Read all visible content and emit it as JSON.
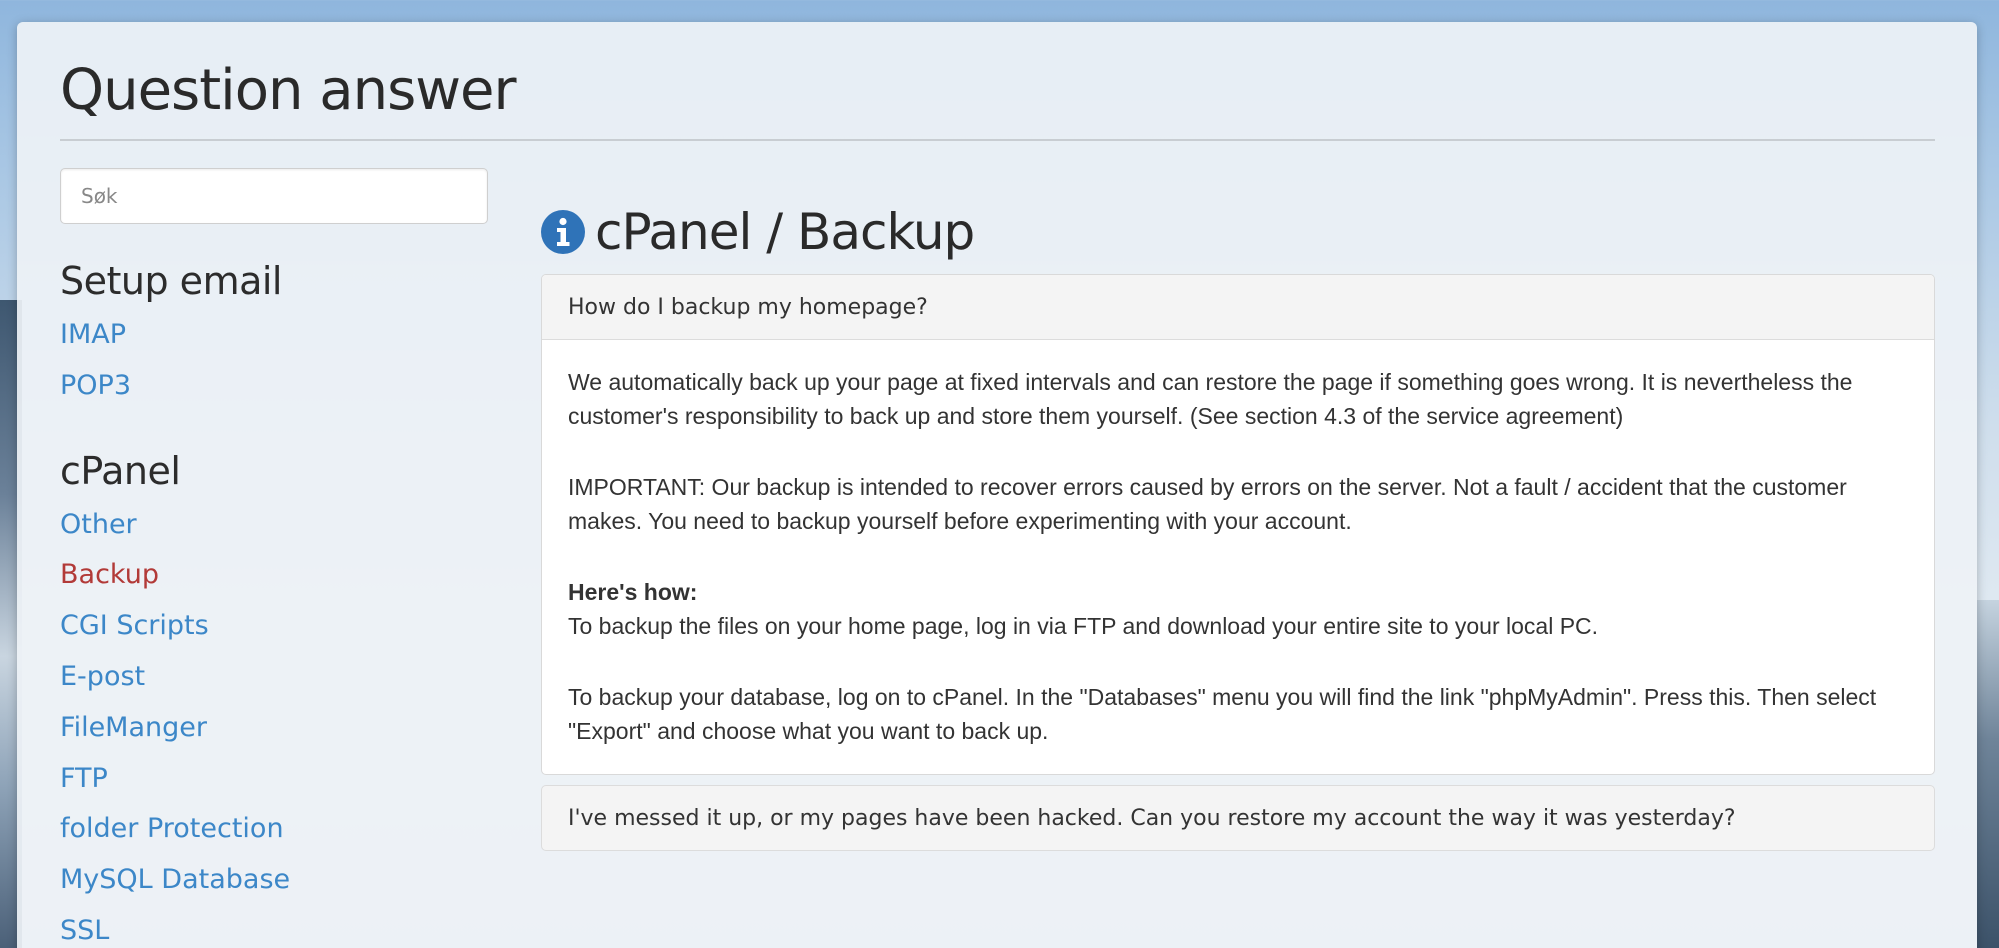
{
  "page": {
    "title": "Question answer"
  },
  "search": {
    "placeholder": "Søk"
  },
  "sidebar": {
    "sections": [
      {
        "heading": "Setup email",
        "items": [
          {
            "label": "IMAP",
            "active": false
          },
          {
            "label": "POP3",
            "active": false
          }
        ]
      },
      {
        "heading": "cPanel",
        "items": [
          {
            "label": "Other",
            "active": false
          },
          {
            "label": "Backup",
            "active": true
          },
          {
            "label": "CGI Scripts",
            "active": false
          },
          {
            "label": "E-post",
            "active": false
          },
          {
            "label": "FileManger",
            "active": false
          },
          {
            "label": "FTP",
            "active": false
          },
          {
            "label": "folder Protection",
            "active": false
          },
          {
            "label": "MySQL Database",
            "active": false
          },
          {
            "label": "SSL",
            "active": false
          }
        ]
      }
    ]
  },
  "main": {
    "icon": "info-circle-icon",
    "title": "cPanel / Backup",
    "questions": [
      {
        "question": "How do I backup my homepage?",
        "answer": {
          "p1": "We automatically back up your page at fixed intervals and can restore the page if something goes wrong. It is nevertheless the customer's responsibility to back up and store them yourself. (See section 4.3 of the service agreement)",
          "p2": "IMPORTANT: Our backup is intended to recover errors caused by errors on the server. Not a fault / accident that the customer makes. You need to backup yourself before experimenting with your account.",
          "p3_bold": "Here's how:",
          "p3_text": "To backup the files on your home page, log in via FTP and download your entire site to your local PC.",
          "p4": "To backup your database, log on to cPanel. In the \"Databases\" menu you will find the link \"phpMyAdmin\". Press this. Then select \"Export\" and choose what you want to back up."
        }
      },
      {
        "question": "I've messed it up, or my pages have been hacked. Can you restore my account the way it was yesterday?"
      }
    ]
  },
  "colors": {
    "link": "#3c87c8",
    "active_link": "#b23a38",
    "icon": "#2f73b8"
  }
}
